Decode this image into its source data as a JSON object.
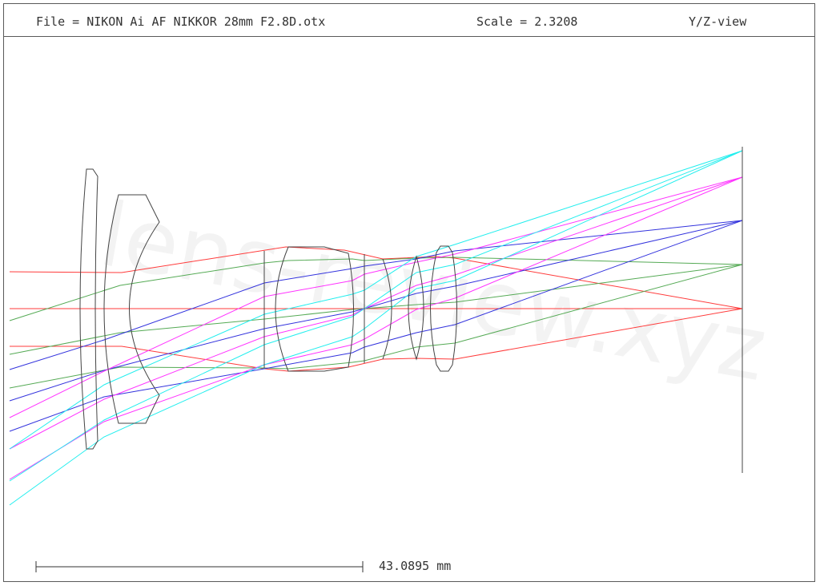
{
  "header": {
    "file": "File = NIKON Ai AF NIKKOR 28mm F2.8D.otx",
    "scale": "Scale = 2.3208",
    "view": "Y/Z-view"
  },
  "scale_bar": {
    "label": "43.0895 mm"
  },
  "watermark": "lens-review.xyz",
  "colors": {
    "frame": "#5a5a5a",
    "lens": "#444444",
    "ray_red": "#ff3b3b",
    "ray_green": "#55aa55",
    "ray_blue": "#3333dd",
    "ray_magenta": "#ff33ff",
    "ray_cyan": "#22eeee"
  }
}
